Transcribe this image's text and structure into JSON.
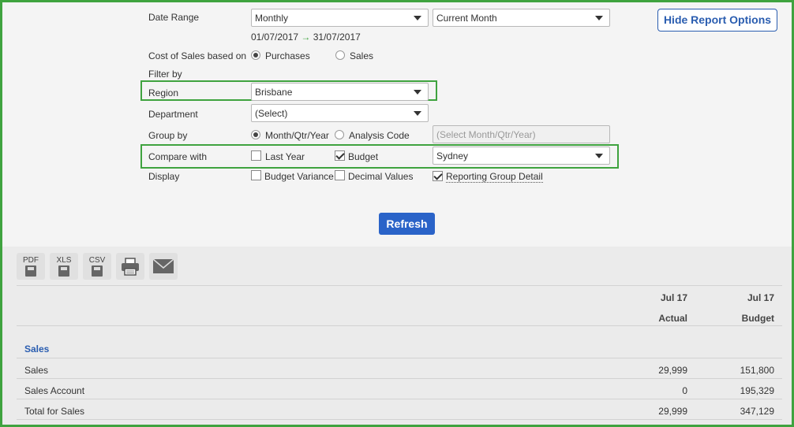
{
  "options": {
    "date_range_label": "Date Range",
    "period_select": "Monthly",
    "month_select": "Current Month",
    "date_from": "01/07/2017",
    "date_to": "31/07/2017",
    "hide_button": "Hide Report Options",
    "cost_of_sales_label": "Cost of Sales based on",
    "cos_purchases": "Purchases",
    "cos_sales": "Sales",
    "filter_by_label": "Filter by",
    "region_label": "Region",
    "region_value": "Brisbane",
    "department_label": "Department",
    "department_value": "(Select)",
    "group_by_label": "Group by",
    "group_month": "Month/Qtr/Year",
    "group_analysis": "Analysis Code",
    "group_select_placeholder": "(Select Month/Qtr/Year)",
    "compare_label": "Compare with",
    "compare_last_year": "Last Year",
    "compare_budget": "Budget",
    "compare_budget_value": "Sydney",
    "display_label": "Display",
    "display_budget_variance": "Budget Variance",
    "display_decimal": "Decimal Values",
    "display_reporting_group": "Reporting Group Detail",
    "refresh_button": "Refresh"
  },
  "toolbar": {
    "pdf": "PDF",
    "xls": "XLS",
    "csv": "CSV",
    "print_icon": "printer-icon",
    "email_icon": "envelope-icon"
  },
  "report": {
    "col1_period": "Jul 17",
    "col1_type": "Actual",
    "col2_period": "Jul 17",
    "col2_type": "Budget",
    "section_title": "Sales",
    "rows": [
      {
        "label": "Sales",
        "actual": "29,999",
        "budget": "151,800"
      },
      {
        "label": "Sales Account",
        "actual": "0",
        "budget": "195,329"
      },
      {
        "label": "Total for Sales",
        "actual": "29,999",
        "budget": "347,129"
      }
    ]
  },
  "colors": {
    "highlight": "#3fa33f",
    "accent": "#2a5db0",
    "refresh_bg": "#2a63c8"
  }
}
